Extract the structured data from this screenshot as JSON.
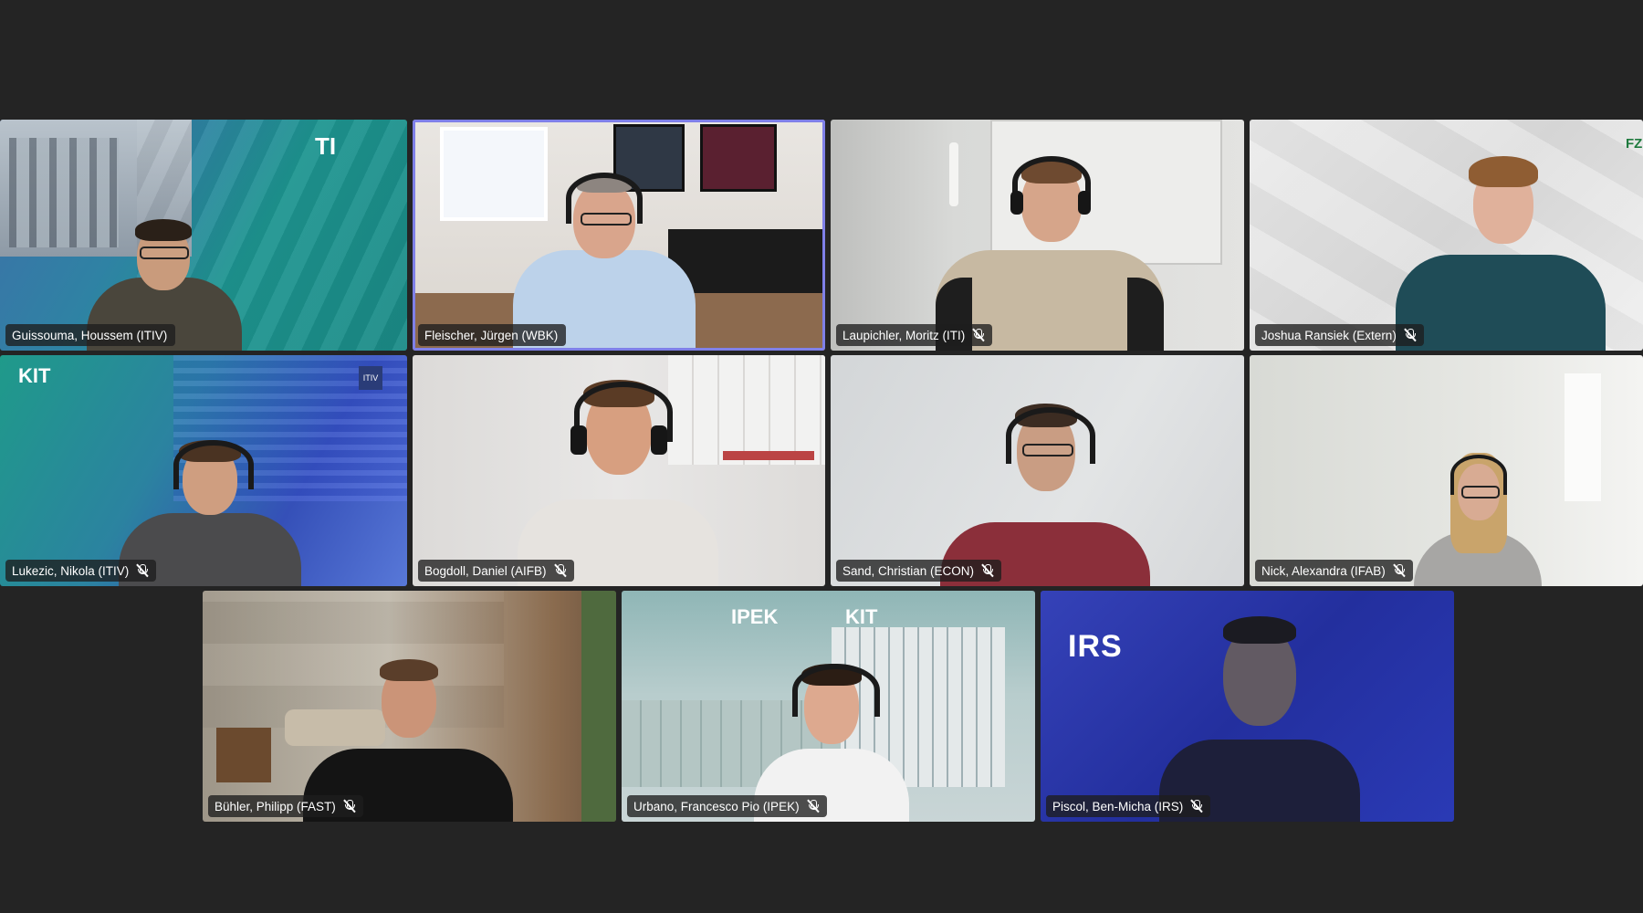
{
  "meeting": {
    "participants": [
      {
        "name": "Guissouma, Houssem (ITIV)",
        "muted": false,
        "speaking": false
      },
      {
        "name": "Fleischer, Jürgen (WBK)",
        "muted": false,
        "speaking": true
      },
      {
        "name": "Laupichler, Moritz (ITI)",
        "muted": true,
        "speaking": false
      },
      {
        "name": "Joshua Ransiek (Extern)",
        "muted": true,
        "speaking": false
      },
      {
        "name": "Lukezic, Nikola (ITIV)",
        "muted": true,
        "speaking": false
      },
      {
        "name": "Bogdoll, Daniel (AIFB)",
        "muted": true,
        "speaking": false
      },
      {
        "name": "Sand, Christian (ECON)",
        "muted": true,
        "speaking": false
      },
      {
        "name": "Nick, Alexandra (IFAB)",
        "muted": true,
        "speaking": false
      },
      {
        "name": "Bühler, Philipp (FAST)",
        "muted": true,
        "speaking": false
      },
      {
        "name": "Urbano, Francesco Pio (IPEK)",
        "muted": true,
        "speaking": false
      },
      {
        "name": "Piscol, Ben-Micha (IRS)",
        "muted": true,
        "speaking": false
      }
    ]
  },
  "backgrounds": {
    "tile1_logo": "TI",
    "tile4_logo": "FZI",
    "tile5_logo": "KIT",
    "tile5_badge": "ITIV",
    "tile10_logo_left": "IPEK",
    "tile10_logo_right": "KIT",
    "tile11_logo": "IRS"
  },
  "icons": {
    "mic_muted": "mic-off-icon"
  },
  "colors": {
    "stage_bg": "#242424",
    "speaking_border": "#7f80e8",
    "namebar_bg": "rgba(30,30,30,0.78)"
  }
}
